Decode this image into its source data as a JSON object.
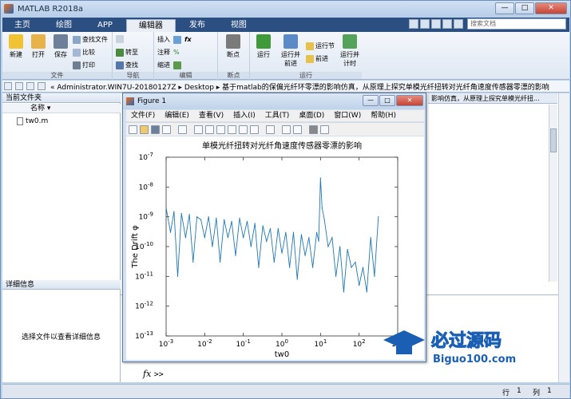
{
  "app": {
    "title": "MATLAB R2018a",
    "window_controls": [
      "—",
      "□",
      "✕"
    ]
  },
  "tabs": [
    {
      "label": "主页",
      "active": false
    },
    {
      "label": "绘图",
      "active": false
    },
    {
      "label": "APP",
      "active": false
    },
    {
      "label": "编辑器",
      "active": true
    },
    {
      "label": "发布",
      "active": false
    },
    {
      "label": "视图",
      "active": false
    }
  ],
  "search": {
    "placeholder": "搜索文档"
  },
  "ribbon": {
    "file": {
      "new": "新建",
      "open": "打开",
      "save": "保存",
      "find_files": "查找文件",
      "compare": "比较",
      "print": "打印",
      "group": "文件"
    },
    "navigate": {
      "goto": "转至",
      "find": "查找",
      "group": "导航"
    },
    "edit": {
      "insert": "插入",
      "comment": "注释",
      "indent": "缩进",
      "group": "编辑"
    },
    "breakpoints": {
      "label": "断点",
      "group": "断点"
    },
    "run": {
      "run": "运行",
      "run_advance": "运行并前进",
      "run_section": "运行节",
      "advance": "前进",
      "run_time": "运行并计时",
      "group": "运行"
    }
  },
  "address": {
    "path": "« Administrator.WIN7U-20180127Z ▸ Desktop ▸ 基于matlab的保偏光纤环零漂的影响仿真，从原理上探究单模光纤扭转对光纤角速度传感器零漂的影响"
  },
  "file_panel": {
    "title": "当前文件夹",
    "col_name": "名称 ▾",
    "files": [
      "tw0.m"
    ]
  },
  "detail_panel": {
    "title": "详细信息",
    "message": "选择文件以查看详细信息"
  },
  "editor_tab": {
    "label": "影响仿真，从原理上探究单模光纤扭..."
  },
  "command": {
    "fx": "fx",
    "prompt": ">>"
  },
  "status": {
    "row_label": "行",
    "row": "1",
    "col_label": "列",
    "col": "1"
  },
  "figure": {
    "title": "Figure 1",
    "menu": [
      "文件(F)",
      "编辑(E)",
      "查看(V)",
      "插入(I)",
      "工具(T)",
      "桌面(D)",
      "窗口(W)",
      "帮助(H)"
    ]
  },
  "watermark": {
    "cn": "必过源码",
    "url": "Biguo100.com"
  },
  "chart_data": {
    "type": "line",
    "title": "单模光纤扭转对光纤角速度传感器零漂的影响",
    "xlabel": "tw0",
    "ylabel": "The Drift φ",
    "xscale": "log",
    "yscale": "log",
    "xlim": [
      0.001,
      1000
    ],
    "ylim": [
      1e-13,
      1e-07
    ],
    "x_ticks": [
      "10^-3",
      "10^-2",
      "10^-1",
      "10^0",
      "10^1",
      "10^2",
      "10^3"
    ],
    "y_ticks": [
      "10^-13",
      "10^-12",
      "10^-11",
      "10^-10",
      "10^-9",
      "10^-8",
      "10^-7"
    ],
    "series": [
      {
        "color": "#1f77b4",
        "x": [
          0.001,
          0.0013,
          0.0016,
          0.002,
          0.0025,
          0.0032,
          0.004,
          0.005,
          0.0063,
          0.008,
          0.01,
          0.0126,
          0.0158,
          0.02,
          0.025,
          0.032,
          0.04,
          0.05,
          0.063,
          0.08,
          0.1,
          0.126,
          0.158,
          0.2,
          0.25,
          0.32,
          0.4,
          0.5,
          0.63,
          0.8,
          1,
          1.26,
          1.58,
          2,
          2.5,
          3.2,
          4,
          5,
          6.3,
          8,
          9,
          10,
          11,
          12.6,
          15.8,
          20,
          25,
          32,
          40,
          50,
          63,
          80,
          100,
          126,
          158,
          200,
          250,
          316
        ],
        "y": [
          2e-09,
          3e-10,
          1.5e-09,
          1e-11,
          1.3e-09,
          2e-10,
          1.2e-09,
          3e-11,
          1e-09,
          8e-10,
          2e-10,
          1e-09,
          1e-10,
          9e-10,
          3e-11,
          8e-10,
          2e-10,
          7e-10,
          5e-11,
          9e-10,
          2e-10,
          7e-10,
          1e-10,
          6e-10,
          2e-11,
          5e-10,
          1.5e-10,
          4e-10,
          3e-11,
          4e-10,
          6e-11,
          3e-10,
          2e-11,
          3e-10,
          8e-12,
          2.5e-10,
          5e-11,
          2e-10,
          2e-11,
          3e-10,
          1.5e-10,
          2e-08,
          2e-09,
          8e-10,
          1e-10,
          2e-10,
          1e-11,
          1e-10,
          3e-12,
          8e-11,
          2e-11,
          3e-11,
          5e-12,
          2e-11,
          3e-12,
          2e-10,
          1e-11,
          1e-09
        ]
      }
    ]
  }
}
